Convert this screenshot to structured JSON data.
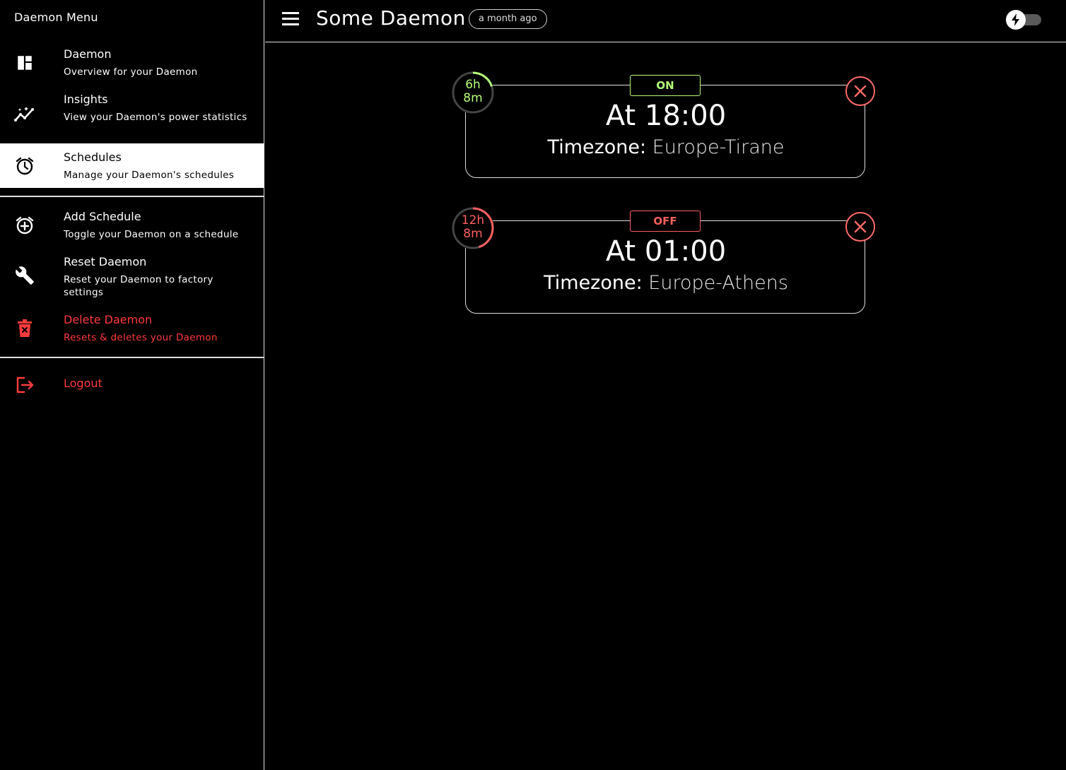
{
  "sidebar": {
    "title": "Daemon Menu",
    "items": [
      {
        "label": "Daemon",
        "sub": "Overview for your Daemon",
        "icon": "dashboard-icon"
      },
      {
        "label": "Insights",
        "sub": "View your Daemon's power statistics",
        "icon": "insights-icon"
      },
      {
        "label": "Schedules",
        "sub": "Manage your Daemon's schedules",
        "icon": "alarm-icon",
        "active": true
      },
      {
        "label": "Add Schedule",
        "sub": "Toggle your Daemon on a schedule",
        "icon": "alarm-add-icon"
      },
      {
        "label": "Reset Daemon",
        "sub": "Reset your Daemon to factory settings",
        "icon": "wrench-icon"
      },
      {
        "label": "Delete Daemon",
        "sub": "Resets & deletes your Daemon",
        "icon": "trash-icon"
      },
      {
        "label": "Logout",
        "icon": "logout-icon"
      }
    ]
  },
  "header": {
    "title": "Some Daemon",
    "last_seen": "a month ago",
    "power_toggle_on": false
  },
  "schedules": [
    {
      "status": "ON",
      "timer_hours": "6h",
      "timer_minutes": "8m",
      "timer_progress": 0.2,
      "time": "At 18:00",
      "tz_label": "Timezone:",
      "tz_value": "Europe-Tirane"
    },
    {
      "status": "OFF",
      "timer_hours": "12h",
      "timer_minutes": "8m",
      "timer_progress": 0.45,
      "time": "At 01:00",
      "tz_label": "Timezone:",
      "tz_value": "Europe-Athens"
    }
  ],
  "colors": {
    "on": "#b5ff7a",
    "off": "#ff6060",
    "danger": "#ff3b3b",
    "background": "#000000"
  }
}
